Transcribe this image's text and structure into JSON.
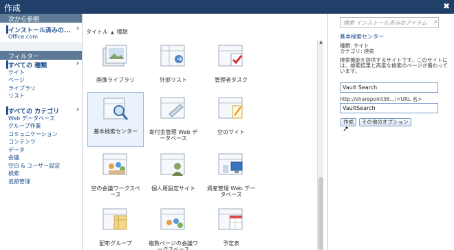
{
  "window": {
    "title": "作成",
    "close": "✖"
  },
  "left": {
    "browse_header": "次から参照",
    "installed": {
      "label": "インストール済みの...",
      "items": [
        "Office.com"
      ]
    },
    "filter_header": "フィルター",
    "all_types": {
      "label": "すべての 種類",
      "items": [
        "サイト",
        "ページ",
        "ライブラリ",
        "リスト"
      ]
    },
    "all_categories": {
      "label": "すべての カテゴリ",
      "items": [
        "Web データベース",
        "グループ作業",
        "コミュニケーション",
        "コンテンツ",
        "データ",
        "会議",
        "空白 & ユーザー設定",
        "検索",
        "追跡管理"
      ]
    }
  },
  "main": {
    "sort": {
      "title": "タイトル",
      "type": "種類"
    },
    "tiles": [
      {
        "label": "画像ライブラリ"
      },
      {
        "label": "外部リスト"
      },
      {
        "label": "管理者タスク"
      },
      {
        "label": "基本検索センター"
      },
      {
        "label": "寄付金管理 Web データベース"
      },
      {
        "label": "空のサイト"
      },
      {
        "label": "空の会議ワークスペース"
      },
      {
        "label": "個人用設定サイト"
      },
      {
        "label": "資産管理 Web データベース"
      },
      {
        "label": "配布グループ"
      },
      {
        "label": "複数ページの会議ワークスペース"
      },
      {
        "label": "予定表"
      }
    ]
  },
  "right": {
    "search_placeholder": "検索 インストール済みのアイテム",
    "title": "基本検索センター",
    "type_line": "種類: サイト",
    "category_line": "カテゴリ: 検索",
    "desc": [
      "検索機能を提供するサイトです。このサイトに",
      "は、検索結果と高度な検索のページが備わって",
      "います。"
    ],
    "name_value": "Vault Search",
    "url_label": "http://sharepoint38.../<URL 名>",
    "url_value": "VaultSearch",
    "create_label": "作成",
    "more_options_label": "その他のオプション"
  }
}
